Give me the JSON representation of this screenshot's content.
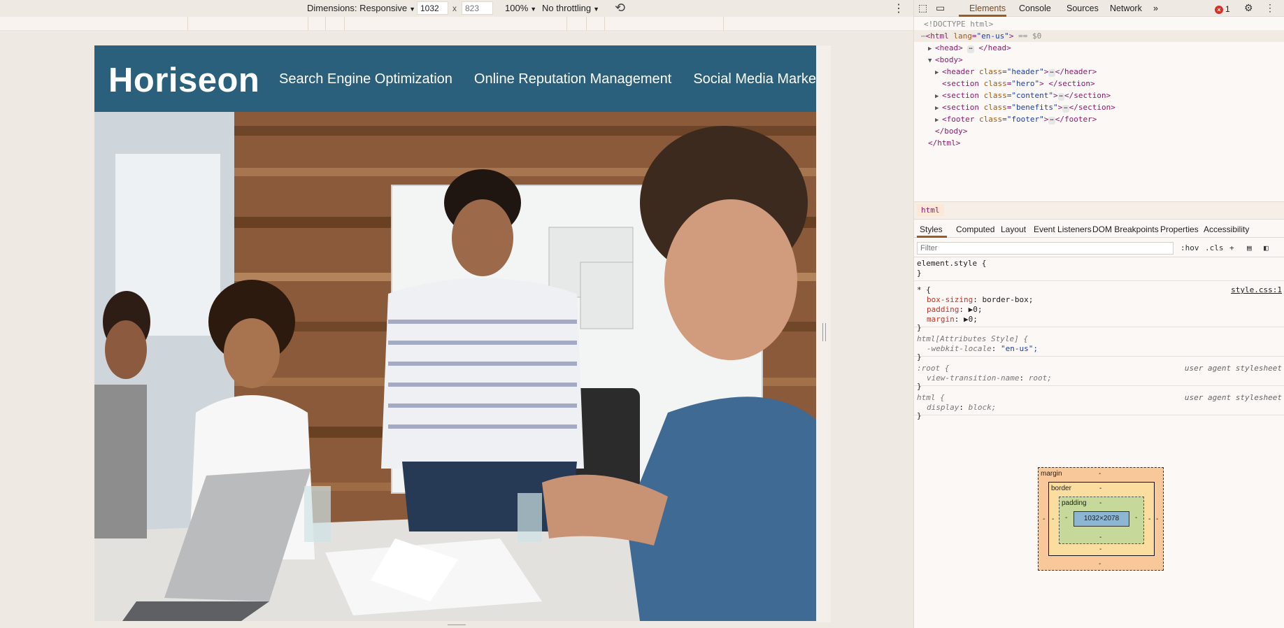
{
  "device_toolbar": {
    "dimensions_label": "Dimensions: Responsive",
    "width_value": "1032",
    "height_placeholder": "823",
    "times": "x",
    "zoom": "100%",
    "throttling": "No throttling"
  },
  "site": {
    "logo": "Horiseon",
    "nav": [
      "Search Engine Optimization",
      "Online Reputation Management",
      "Social Media Marketing"
    ]
  },
  "devtools": {
    "tabs": [
      "Elements",
      "Console",
      "Sources",
      "Network"
    ],
    "more_tabs": "»",
    "error_count": "1",
    "dom": {
      "doctype": "<!DOCTYPE html>",
      "html_open_tag": "html",
      "html_attr": "lang",
      "html_attr_val": "\"en-us\"",
      "selected_marker": "== $0",
      "head": "head",
      "body": "body",
      "header_tag": "header",
      "header_class": "\"header\"",
      "hero_tag": "section",
      "hero_class": "\"hero\"",
      "content_class": "\"content\"",
      "benefits_class": "\"benefits\"",
      "footer_tag": "footer",
      "footer_class": "\"footer\"",
      "body_close": "</body>",
      "html_close": "</html>"
    },
    "breadcrumb": "html",
    "subtabs": [
      "Styles",
      "Computed",
      "Layout",
      "Event Listeners",
      "DOM Breakpoints",
      "Properties",
      "Accessibility"
    ],
    "filter_placeholder": "Filter",
    "hov": ":hov",
    "cls": ".cls",
    "rules": {
      "element_style": "element.style {",
      "close": "}",
      "star_selector": "* {",
      "star_source": "style.css:1",
      "box_sizing_prop": "box-sizing",
      "box_sizing_val": "border-box;",
      "padding_prop": "padding",
      "padding_val": "0;",
      "margin_prop": "margin",
      "margin_val": "0;",
      "attr_selector": "html[Attributes Style] {",
      "locale_prop": "-webkit-locale",
      "locale_val": "\"en-us\";",
      "root_selector": ":root {",
      "ua_source": "user agent stylesheet",
      "vt_prop": "view-transition-name",
      "vt_val": "root;",
      "html_selector": "html {",
      "display_prop": "display",
      "display_val": "block;"
    },
    "box_model": {
      "margin_label": "margin",
      "border_label": "border",
      "padding_label": "padding",
      "dash": "-",
      "content_size": "1032×2078"
    }
  }
}
